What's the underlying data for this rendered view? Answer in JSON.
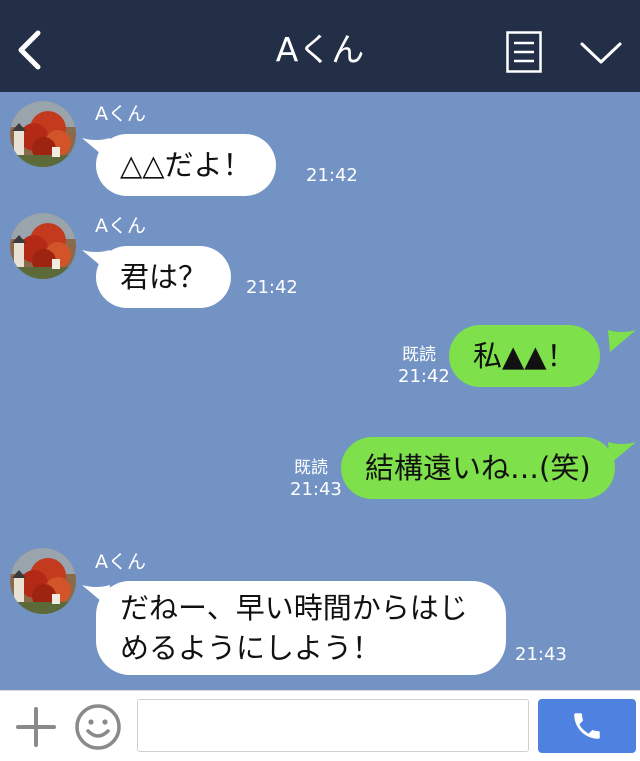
{
  "header": {
    "title": "Aくん",
    "icons": [
      "back-icon",
      "menu-icon",
      "chevron-down-icon"
    ],
    "bg_color": "#232e47"
  },
  "chat": {
    "bg_color": "#7293c4",
    "incoming_bubble_color": "#ffffff",
    "outgoing_bubble_color": "#7ee04a",
    "messages": [
      {
        "direction": "in",
        "sender": "Aくん",
        "text": "△△だよ！",
        "time": "21:42"
      },
      {
        "direction": "in",
        "sender": "Aくん",
        "text": "君は？",
        "time": "21:42"
      },
      {
        "direction": "out",
        "read": "既読",
        "text": "私▲▲！",
        "time": "21:42"
      },
      {
        "direction": "out",
        "read": "既読",
        "text": "結構遠いね…(笑)",
        "time": "21:43"
      },
      {
        "direction": "in",
        "sender": "Aくん",
        "text_line1": "だねー、早い時間からはじ",
        "text_line2": "めるようにしよう！",
        "time": "21:43"
      }
    ]
  },
  "footer": {
    "input_value": "",
    "icons": [
      "plus-icon",
      "smile-icon",
      "phone-icon"
    ],
    "call_color": "#4f82e0"
  }
}
